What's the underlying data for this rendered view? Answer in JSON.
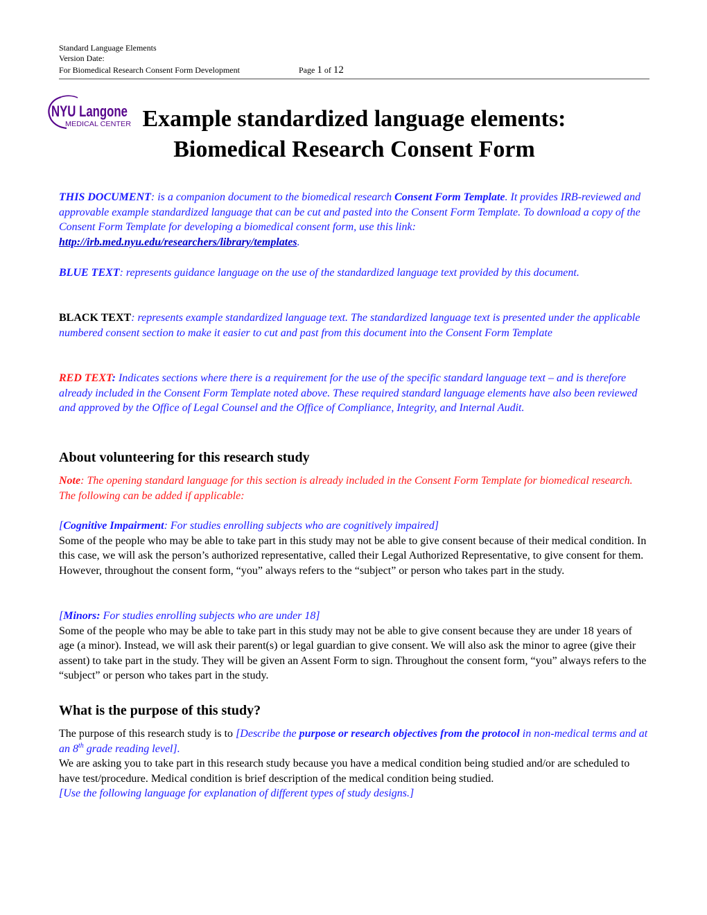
{
  "header": {
    "line1": "Standard Language Elements",
    "line2": "Version Date:",
    "line3": "For Biomedical Research Consent Form Development",
    "page_prefix": "Page ",
    "page_current": "1",
    "page_of": " of ",
    "page_total": "12"
  },
  "logo": {
    "brand": "NYU Langone",
    "brand_nyu": "NYU",
    "brand_langone": "Langone",
    "subtitle": "MEDICAL CENTER",
    "color": "#57068c"
  },
  "title": {
    "line1": "Example standardized language elements:",
    "line2": "Biomedical Research Consent Form"
  },
  "colors": {
    "guidance_blue": "#1a1aff",
    "required_red": "#ff1a1a",
    "link": "#0000cc",
    "text": "#000000"
  },
  "intro": {
    "this_document": {
      "label": "THIS DOCUMENT",
      "sep": ": ",
      "text1": "is a companion document to the biomedical research ",
      "bold_term": "Consent Form Template",
      "text2": ".  It provides IRB-reviewed and approvable example standardized language that can be cut and pasted into the Consent Form Template.  To download a copy of the Consent Form Template for developing a biomedical consent form, use this link: ",
      "link": "http://irb.med.nyu.edu/researchers/library/templates",
      "end": "."
    },
    "blue_text": {
      "label": "BLUE TEXT",
      "text": ": represents guidance language on the use of the standardized language text provided by this document."
    },
    "black_text": {
      "label": "BLACK TEXT",
      "text": ": represents example standardized language text.  The standardized language text is presented under the applicable numbered consent section to make it easier to cut and past from this document into the Consent Form Template"
    },
    "red_text": {
      "label": "RED TEXT",
      "colon": ":",
      "text": " Indicates sections where there is a requirement for the use of the specific standard language text – and is therefore already included in the Consent Form Template noted above.  These required standard language elements have also been reviewed and approved by the Office of Legal Counsel and the Office of Compliance, Integrity, and Internal Audit."
    }
  },
  "sections": [
    {
      "heading": "About volunteering for this research study",
      "note_label": "Note",
      "note_text": ": The opening standard language for this section is already included in the Consent Form Template for biomedical research.  The following can be added if applicable:",
      "subsections": [
        {
          "open": "[",
          "label": "Cognitive Impairment",
          "guidance": ": For studies enrolling subjects who are cognitively impaired]",
          "body": "Some of the people who may be able to take part in this study may not be able to give consent because of their medical condition. In this case, we will ask the person’s authorized representative, called their Legal Authorized Representative, to give consent for them. However, throughout the consent form, “you” always refers to the “subject” or person who takes part in the study."
        },
        {
          "open": "[",
          "label": "Minors:",
          "guidance": " For studies enrolling subjects who are under 18]",
          "body": "Some of the people who may be able to take part in this study may not be able to give consent because they are under 18 years of age (a minor). Instead, we will ask their parent(s) or legal guardian to give consent. We will also ask the minor to agree (give their assent) to take part in the study. They will be given an Assent Form to sign. Throughout the consent form, “you” always refers to the “subject” or person who takes part in the study."
        }
      ]
    },
    {
      "heading": "What is the purpose of this study?",
      "purpose_lead": "The purpose of this research study is to ",
      "purpose_guidance1": "[Describe the ",
      "purpose_bold": "purpose or research objectives from the protocol",
      "purpose_guidance2": " in non-medical terms and at an 8",
      "purpose_sup": "th",
      "purpose_guidance3": " grade reading level].",
      "body": "We are asking you to take part in this research study because you have a medical condition being studied and/or are scheduled to have test/procedure. Medical condition is brief description of the medical condition being studied.",
      "guidance_end": "[Use the following language for explanation of different types of study designs.]"
    }
  ]
}
